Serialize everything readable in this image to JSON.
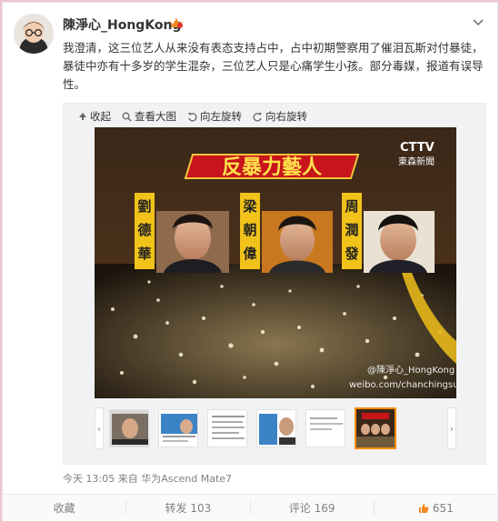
{
  "post": {
    "username": "陳淨心_HongKong",
    "text": "我澄清，这三位艺人从来没有表态支持占中，占中初期警察用了催泪瓦斯对付暴徒，暴徒中亦有十多岁的学生混杂，三位艺人只是心痛学生小孩。部分毒媒，报道有误导性。",
    "meta": "今天 13:05 来自 华为Ascend Mate7"
  },
  "toolbar": {
    "collapse": "收起",
    "view_large": "查看大图",
    "rotate_left": "向左旋转",
    "rotate_right": "向右旋转"
  },
  "image": {
    "banner": "反暴力藝人",
    "channel_logo": "CTTV",
    "channel_name": "東森新聞",
    "names": [
      "劉德華",
      "梁朝偉",
      "周潤發"
    ],
    "watermark_user": "@陳淨心_HongKong",
    "watermark_url": "weibo.com/chanchingsum"
  },
  "actions": {
    "favorite": "收藏",
    "repost": "转发 103",
    "comment": "评论 169",
    "like": "651"
  },
  "colors": {
    "accent": "#ff8c00",
    "banner_red": "#c8141b",
    "name_yellow": "#f1c21a"
  }
}
